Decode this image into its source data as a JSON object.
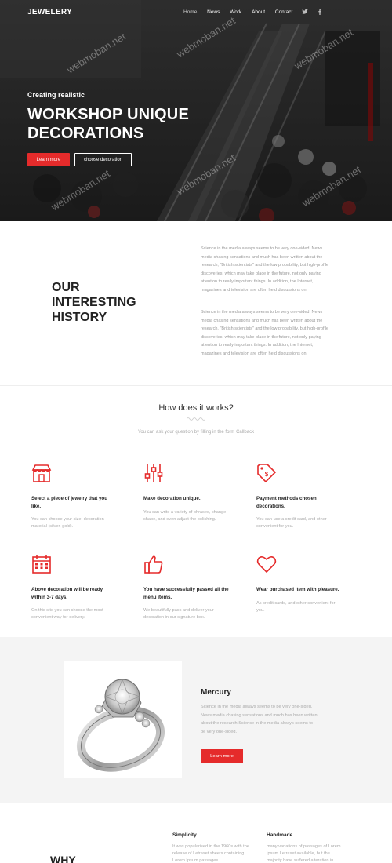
{
  "nav": {
    "logo": "JEWELERY",
    "items": [
      "Home.",
      "News.",
      "Work.",
      "About.",
      "Contact."
    ],
    "social": [
      "twitter-icon",
      "facebook-icon"
    ]
  },
  "hero": {
    "subtitle": "Creating realistic",
    "title": "WORKSHOP UNIQUE DECORATIONS",
    "btn_primary": "Learn more",
    "btn_secondary": "choose decoration",
    "watermark": "webmoban.net"
  },
  "history": {
    "title": "OUR INTERESTING HISTORY",
    "paragraphs": [
      "Science in the media always seems to be very one-sided. News media chasing sensations and much has been written about the research, \"British scientists\" and the low probability, but high-profile discoveries, which may take place in the future, not only paying attention to really important things. In addition, the Internet, magazines and television are often held discussions on",
      "Science in the media always seems to be very one-sided. News media chasing sensations and much has been written about the research, \"British scientists\" and the low probability, but high-profile discoveries, which may take place in the future, not only paying attention to really important things. In addition, the Internet, magazines and television are often held discussions on"
    ]
  },
  "how": {
    "title": "How does it works?",
    "subtitle": "You can ask your question by filling in the form Callback",
    "features": [
      {
        "icon": "shop-icon",
        "title": "Select a piece of jewelry that you like.",
        "text": "You can choose your size, decoration material (silver, gold)."
      },
      {
        "icon": "sliders-icon",
        "title": "Make decoration unique.",
        "text": "You can write a variety of phrases, change shape, and even adjust the polishing."
      },
      {
        "icon": "payment-tag-icon",
        "title": "Payment methods chosen decorations.",
        "text": "You can use a credit card, and other convenient for you."
      },
      {
        "icon": "calendar-icon",
        "title": "Above decoration will be ready within 3-7 days.",
        "text": "On this site you can choose the most convenient way for delivery."
      },
      {
        "icon": "thumbs-up-icon",
        "title": "You have successfully passed all the menu items.",
        "text": "We beautifully pack and deliver your decoration in our signature box."
      },
      {
        "icon": "heart-icon",
        "title": "Wear purchased item with pleasure.",
        "text": "As credit cards, and other convenient for you."
      }
    ]
  },
  "mercury": {
    "title": "Mercury",
    "text": "Science in the media always seems to be very one-sided. News media chasing sensations and much has been written about the research Science in the media always seems to be very one-sided.",
    "button": "Learn more"
  },
  "why": {
    "title": "WHY",
    "columns": [
      {
        "title": "Simplicity",
        "text": "It was popularised in the 1960s with the release of Letraset sheets containing Lorem Ipsum passages"
      },
      {
        "title": "Handmade",
        "text": "many variations of passages of Lorem Ipsum Letraset available, but the majority have suffered alteration in"
      }
    ]
  },
  "colors": {
    "accent": "#e52b2b",
    "muted": "#aaaaaa"
  }
}
